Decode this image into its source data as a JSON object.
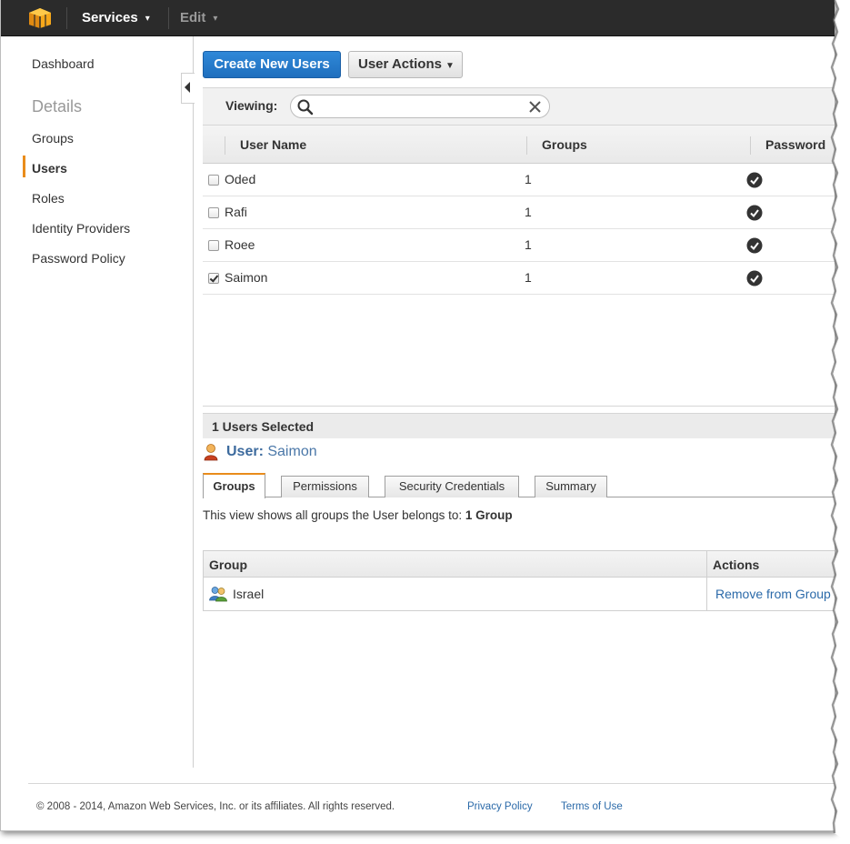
{
  "topbar": {
    "services_label": "Services",
    "edit_label": "Edit"
  },
  "sidebar": {
    "dashboard": "Dashboard",
    "heading": "Details",
    "items": [
      "Groups",
      "Users",
      "Roles",
      "Identity Providers",
      "Password Policy"
    ],
    "active": "Users"
  },
  "toolbar": {
    "create_label": "Create New Users",
    "actions_label": "User Actions"
  },
  "filter": {
    "label": "Viewing:",
    "value": ""
  },
  "users_table": {
    "columns": [
      "User Name",
      "Groups",
      "Password"
    ],
    "rows": [
      {
        "name": "Oded",
        "groups": "1",
        "password": true,
        "checked": false
      },
      {
        "name": "Rafi",
        "groups": "1",
        "password": true,
        "checked": false
      },
      {
        "name": "Roee",
        "groups": "1",
        "password": true,
        "checked": false
      },
      {
        "name": "Saimon",
        "groups": "1",
        "password": true,
        "checked": true
      }
    ]
  },
  "selection": {
    "count_label": "1 Users Selected",
    "user_prefix": "User:",
    "user_name": "Saimon"
  },
  "tabs": {
    "items": [
      "Groups",
      "Permissions",
      "Security Credentials",
      "Summary"
    ],
    "active": "Groups"
  },
  "groups_view": {
    "description": "This view shows all groups the User belongs to:",
    "count": "1 Group",
    "columns": [
      "Group",
      "Actions"
    ],
    "rows": [
      {
        "name": "Israel",
        "action": "Remove from Group"
      }
    ]
  },
  "footer": {
    "copyright": "© 2008 - 2014, Amazon Web Services, Inc. or its affiliates. All rights reserved.",
    "privacy": "Privacy Policy",
    "terms": "Terms of Use"
  },
  "colors": {
    "accent_orange": "#e98c1b",
    "primary_blue": "#1f6fbe",
    "link_blue": "#2b6aa9",
    "topbar": "#2b2b2b"
  }
}
